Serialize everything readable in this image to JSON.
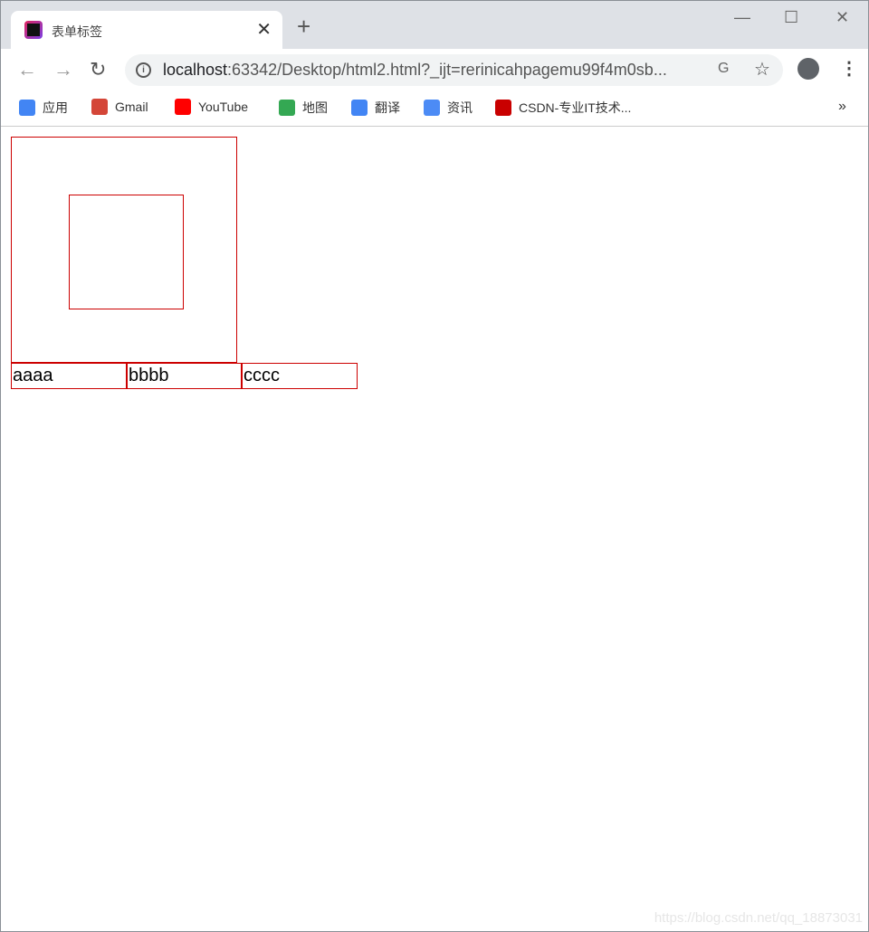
{
  "browser": {
    "tab_title": "表单标签",
    "url_host": "localhost",
    "url_rest": ":63342/Desktop/html2.html?_ijt=rerinicahpagemu99f4m0sb...",
    "bookmarks": [
      {
        "label": "应用",
        "icon": "apps-grid-icon",
        "color": "#4285f4"
      },
      {
        "label": "Gmail",
        "icon": "gmail-icon",
        "color": "#d44638"
      },
      {
        "label": "YouTube",
        "icon": "youtube-icon",
        "color": "#ff0000"
      },
      {
        "label": "地图",
        "icon": "maps-icon",
        "color": "#34a853"
      },
      {
        "label": "翻译",
        "icon": "translate-icon",
        "color": "#4285f4"
      },
      {
        "label": "资讯",
        "icon": "news-icon",
        "color": "#4c8bf5"
      },
      {
        "label": "CSDN-专业IT技术...",
        "icon": "csdn-icon",
        "color": "#c90000"
      }
    ],
    "more": "»"
  },
  "page": {
    "cells": [
      "aaaa",
      "bbbb",
      "cccc"
    ],
    "border_color": "#cc0000"
  },
  "watermark": "https://blog.csdn.net/qq_18873031"
}
